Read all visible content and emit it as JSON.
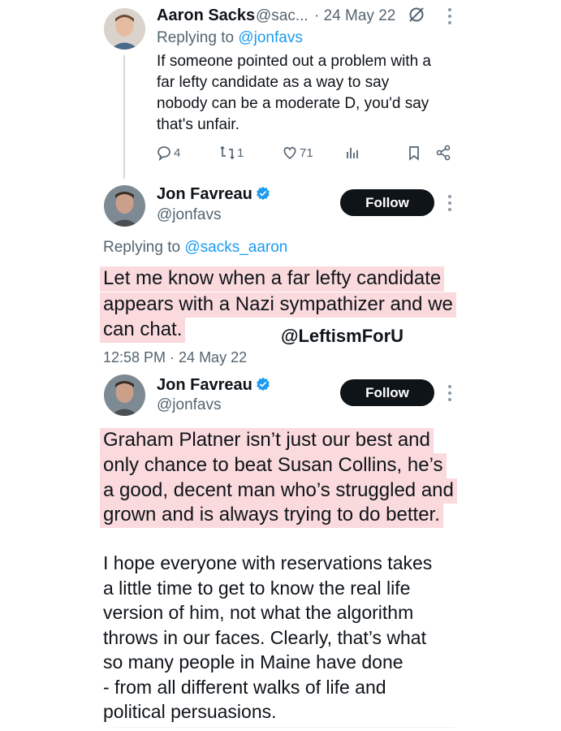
{
  "tweet1": {
    "name": "Aaron Sacks",
    "handle": "@sac...",
    "date": "· 24 May 22",
    "replying_prefix": "Replying to",
    "replying_to": "@jonfavs",
    "text_lines": [
      "If someone pointed out a problem with a",
      "far lefty candidate as a way to say",
      "nobody can be a moderate D, you'd say",
      "that's unfair."
    ],
    "actions": {
      "replies": "4",
      "reposts": "1",
      "likes": "71"
    }
  },
  "tweet2": {
    "name": "Jon Favreau",
    "handle": "@jonfavs",
    "follow_label": "Follow",
    "replying_prefix": "Replying to",
    "replying_to": "@sacks_aaron",
    "text_lines": [
      "Let me know when a far lefty candidate",
      "appears with a Nazi sympathizer and we",
      "can chat."
    ],
    "timestamp": "12:58 PM · 24 May 22"
  },
  "watermark": "@LeftismForU",
  "tweet3": {
    "name": "Jon Favreau",
    "handle": "@jonfavs",
    "follow_label": "Follow",
    "highlight_lines": [
      "Graham Platner isn’t just our best and",
      "only chance to beat Susan Collins, he’s",
      "a good, decent man who’s struggled and",
      "grown and is always trying to do better."
    ],
    "body_lines": [
      "I hope everyone with reservations takes",
      "a little time to get to know the real life",
      "version of him, not what the algorithm",
      "throws in our faces. Clearly, that’s what",
      "so many people in Maine have done",
      "- from all different walks of life and",
      "political persuasions."
    ]
  },
  "colors": {
    "highlight": "#fadadd",
    "link": "#1d9bf0",
    "verified": "#1d9bf0",
    "secondary": "#536471"
  }
}
